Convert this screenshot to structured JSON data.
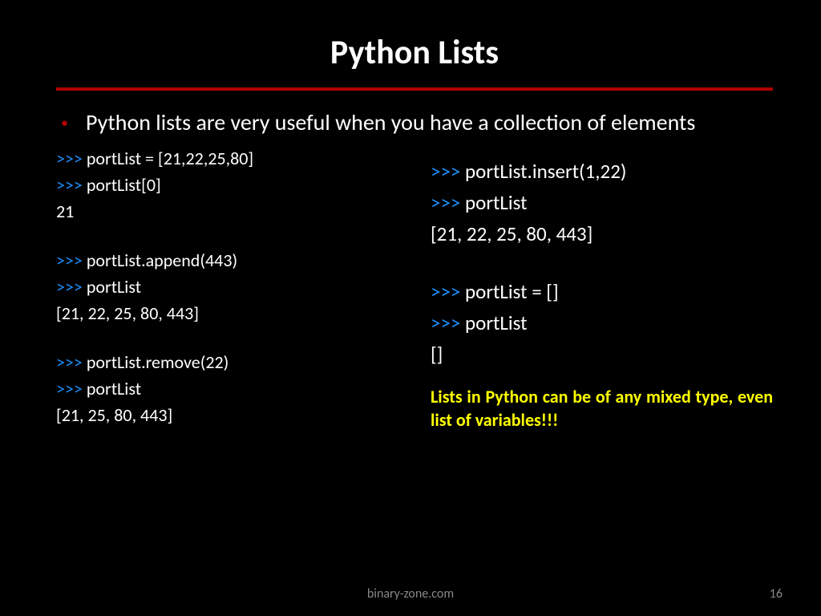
{
  "title": "Python Lists",
  "bullet": "Python lists are very useful when you have a collection of elements",
  "prompt": ">>>",
  "left": {
    "l1": "portList = [21,22,25,80]",
    "l2": "portList[0]",
    "l3": "21",
    "l4": "portList.append(443)",
    "l5": "portList",
    "l6": "[21, 22, 25, 80, 443]",
    "l7": "portList.remove(22)",
    "l8": "portList",
    "l9": "[21, 25, 80, 443]"
  },
  "right": {
    "r1": "portList.insert(1,22)",
    "r2": "portList",
    "r3": "[21, 22, 25, 80, 443]",
    "r4": "portList = []",
    "r5": "portList",
    "r6": "[]"
  },
  "note": "Lists in Python can be of any mixed type, even list of variables!!!",
  "footer_site": "binary-zone.com",
  "footer_page": "16"
}
